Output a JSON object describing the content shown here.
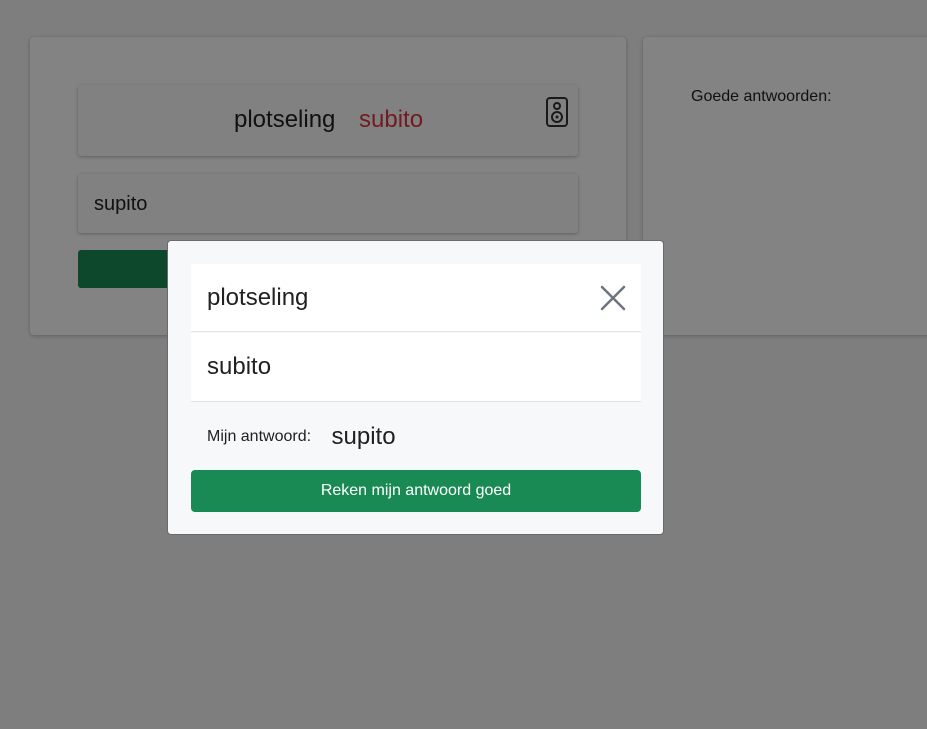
{
  "quiz": {
    "source_word": "plotseling",
    "target_word": "subito",
    "answer_value": "supito",
    "speaker_icon": "speaker-icon"
  },
  "sidebar": {
    "good_answers_label": "Goede antwoorden:"
  },
  "modal": {
    "question": "plotseling",
    "correct_answer": "subito",
    "my_answer_label": "Mijn antwoord:",
    "my_answer_value": "supito",
    "accept_button_label": "Reken mijn antwoord goed",
    "close_icon": "close-icon"
  },
  "colors": {
    "accent_green": "#1a8a55",
    "target_word_red": "#dc3545",
    "overlay": "rgba(0,0,0,0.48)"
  }
}
